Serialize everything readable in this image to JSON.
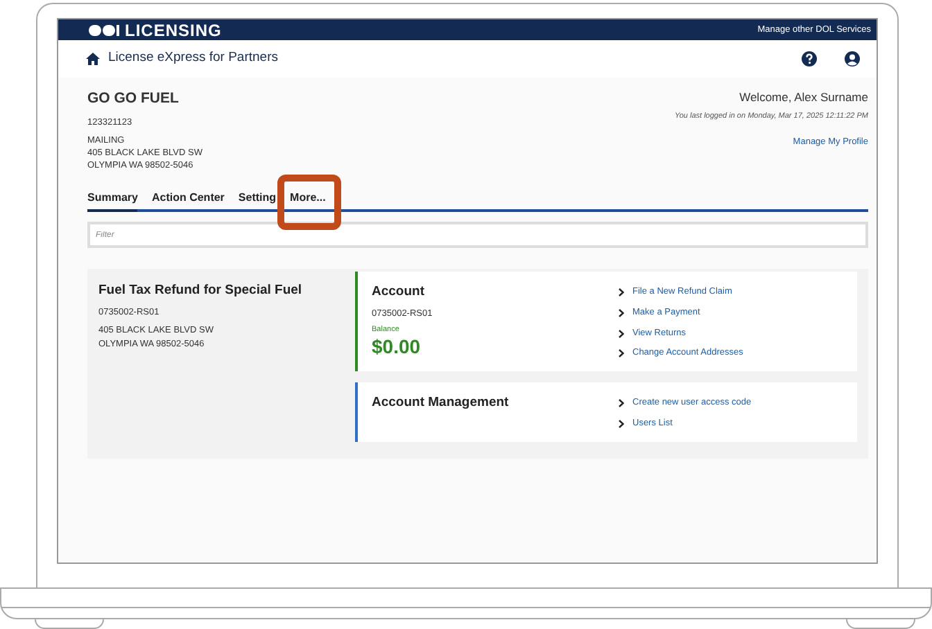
{
  "header": {
    "logo": "LICENSING",
    "link": "Manage other DOL Services"
  },
  "app_bar": {
    "title": "License eXpress for Partners"
  },
  "business": {
    "name": "GO GO FUEL",
    "id": "123321123",
    "address_type": "MAILING",
    "address_lines": [
      "405 BLACK LAKE BLVD SW",
      "OLYMPIA WA 98502-5046"
    ]
  },
  "welcome": {
    "greeting": "Welcome, Alex Surname",
    "last_login": "You last logged in on Monday, Mar 17, 2025 12:11:22 PM",
    "profile_link": "Manage My Profile"
  },
  "tabs": [
    {
      "label": "Summary",
      "selected": true,
      "highlighted": false
    },
    {
      "label": "Action Center",
      "selected": false,
      "highlighted": false
    },
    {
      "label": "Setting",
      "selected": false,
      "highlighted": false
    },
    {
      "label": "More...",
      "selected": false,
      "highlighted": true
    }
  ],
  "filter": {
    "placeholder": "Filter"
  },
  "license": {
    "title": "Fuel Tax Refund for Special Fuel",
    "number": "0735002-RS01",
    "address_lines": [
      "405 BLACK LAKE BLVD SW",
      "OLYMPIA WA 98502-5046"
    ]
  },
  "panels": [
    {
      "title": "Account",
      "number": "0735002-RS01",
      "balance_label": "Balance",
      "balance": "$0.00",
      "color": "#2e8b22",
      "links": [
        "File a New Refund Claim",
        "Make a Payment",
        "View Returns",
        "Change Account Addresses"
      ]
    },
    {
      "title": "Account Management",
      "color": "#2f6fc4",
      "links": [
        "Create new user access code",
        "Users List"
      ]
    }
  ]
}
